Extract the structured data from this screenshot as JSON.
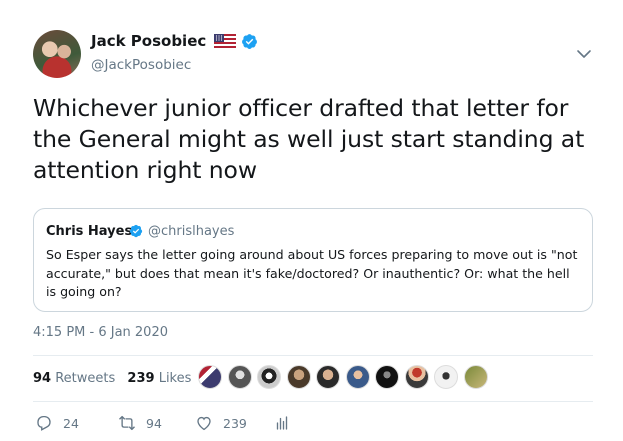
{
  "author": {
    "name": "Jack Posobiec",
    "handle": "@JackPosobiec"
  },
  "tweet": {
    "text": "Whichever junior officer drafted that letter for the General might as well just start standing at attention right now"
  },
  "quoted_tweet": {
    "author_name": "Chris Hayes",
    "author_handle": "@chrislhayes",
    "text": "So Esper says the letter going around about US forces preparing to move out is \"not accurate,\" but does that mean it's fake/doctored? Or inauthentic? Or: what the hell is going on?"
  },
  "timestamp": "4:15 PM - 6 Jan 2020",
  "stats": {
    "retweets_count": "94",
    "retweets_label": "Retweets",
    "likes_count": "239",
    "likes_label": "Likes"
  },
  "actions": {
    "reply_count": "24",
    "retweet_count": "94",
    "like_count": "239"
  },
  "icons": [
    "us-flag-icon",
    "verified-icon",
    "caret-down-icon",
    "reply-icon",
    "retweet-icon",
    "heart-icon",
    "analytics-icon"
  ],
  "colors": {
    "verified": "#1da1f2",
    "muted_text": "#657786",
    "divider": "#e6ecf0"
  }
}
